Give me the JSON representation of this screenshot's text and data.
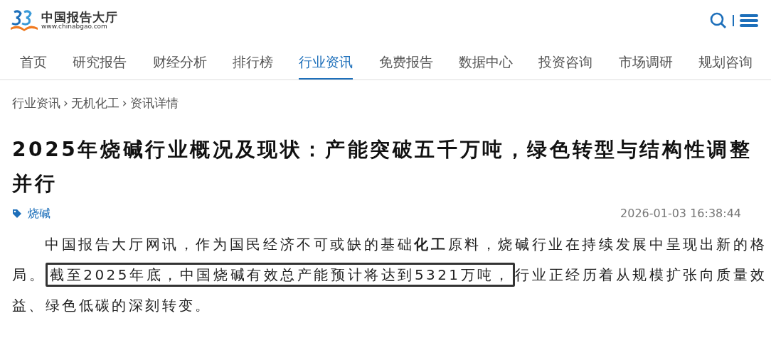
{
  "header": {
    "logo_name": "中国报告大厅",
    "logo_url": "www.chinabgao.com"
  },
  "nav": [
    {
      "label": "首页",
      "selected": false
    },
    {
      "label": "研究报告",
      "selected": false
    },
    {
      "label": "财经分析",
      "selected": false
    },
    {
      "label": "排行榜",
      "selected": false
    },
    {
      "label": "行业资讯",
      "selected": true
    },
    {
      "label": "免费报告",
      "selected": false
    },
    {
      "label": "数据中心",
      "selected": false
    },
    {
      "label": "投资咨询",
      "selected": false
    },
    {
      "label": "市场调研",
      "selected": false
    },
    {
      "label": "规划咨询",
      "selected": false
    }
  ],
  "breadcrumb": [
    "行业资讯",
    "无机化工",
    "资讯详情"
  ],
  "breadcrumb_separator": "›",
  "article": {
    "title": "2025年烧碱行业概况及现状：产能突破五千万吨，绿色转型与结构性调整并行",
    "tag": "烧碱",
    "date": "2026-01-03 16:38:44",
    "paragraph": [
      {
        "text": "中国报告大厅网讯，作为国民经济不可或缺的基础**化工**原料，烧碱行业在持续发展中呈现出新的格局。",
        "highlighted": false
      },
      {
        "text": "截至2025年底，中国烧碱有效总产能预计将达到5321万吨，",
        "highlighted": true
      },
      {
        "text": "行业正经历着从规模扩张向质量效益、绿色低碳的深刻转变。",
        "highlighted": false
      }
    ]
  }
}
